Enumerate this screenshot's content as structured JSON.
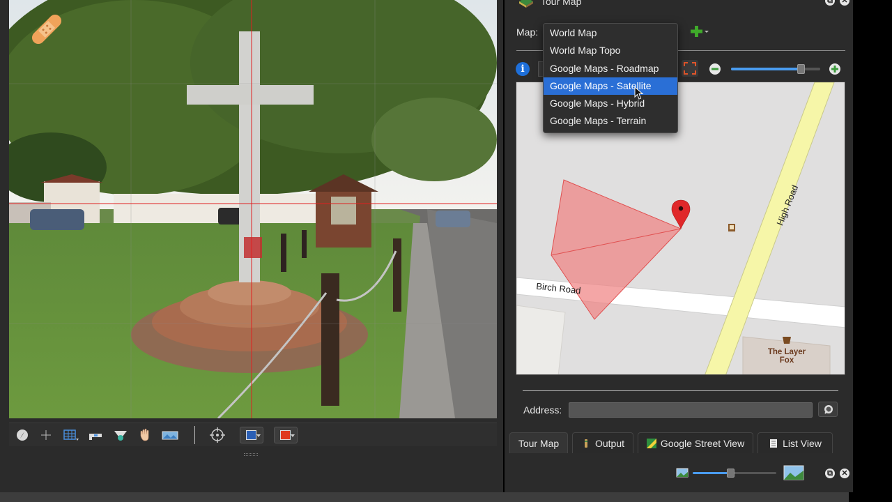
{
  "panel": {
    "title": "Tour Map",
    "icon": "tour-map-icon"
  },
  "map_source": {
    "label": "Map:",
    "options": [
      "World Map",
      "World Map Topo",
      "Google Maps - Roadmap",
      "Google Maps - Satellite",
      "Google Maps - Hybrid",
      "Google Maps - Terrain"
    ],
    "highlighted": "Google Maps - Satellite",
    "add_button_icon": "green-plus-icon"
  },
  "map_toolbar": {
    "info_icon": "info-icon",
    "info_glyph": "i",
    "fit_icon": "fit-to-bounds-icon",
    "zoom_out_icon": "zoom-out-icon",
    "zoom_in_icon": "zoom-in-icon",
    "zoom_level": 0.78
  },
  "map": {
    "road_labels": [
      "High Road",
      "Birch Road"
    ],
    "poi_label_lines": [
      "The Layer",
      "Fox"
    ],
    "marker_icon": "location-pin-icon",
    "poi_icons": [
      "memorial-icon",
      "pub-icon"
    ],
    "colors": {
      "background": "#e0dfdf",
      "major_road": "#f6f6a8",
      "minor_road": "#ffffff",
      "view_cone": "#f08080",
      "marker": "#e0282a"
    }
  },
  "address": {
    "label": "Address:",
    "value": "",
    "search_icon": "search-icon"
  },
  "tabs": [
    {
      "label": "Tour Map",
      "icon": ""
    },
    {
      "label": "Output",
      "icon": "output-icon"
    },
    {
      "label": "Google Street View",
      "icon": "street-view-icon"
    },
    {
      "label": "List View",
      "icon": "list-view-icon"
    }
  ],
  "active_tab": "Tour Map",
  "thumbnail_size": {
    "small_icon": "small-image-icon",
    "large_icon": "large-image-icon",
    "level": 0.45
  },
  "viewer_toolbar": {
    "tools": [
      "compass-icon",
      "add-point-icon",
      "grid-icon",
      "level-icon",
      "view-icon",
      "hand-icon",
      "panorama-icon",
      "target-icon"
    ],
    "colors": [
      {
        "name": "blue-color",
        "value": "#2b5fb5"
      },
      {
        "name": "red-color",
        "value": "#e03a1e"
      }
    ]
  },
  "window_controls": [
    "detach-icon",
    "close-icon"
  ],
  "app_badge": {
    "icon": "bandage-icon",
    "color": "#f0a35a"
  }
}
